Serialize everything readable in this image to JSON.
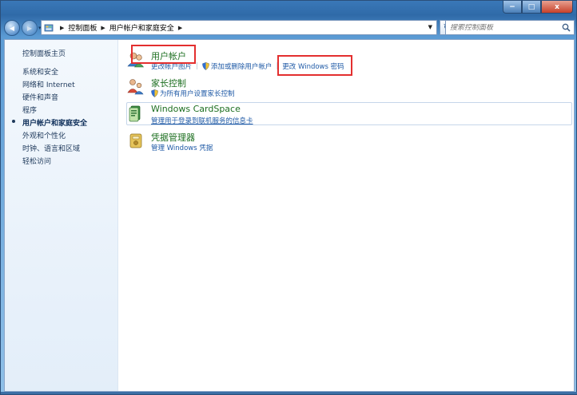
{
  "window": {
    "buttons": {
      "minimize": "−",
      "maximize": "□",
      "close": "x"
    }
  },
  "navbar": {
    "back_glyph": "◀",
    "forward_glyph": "▶",
    "breadcrumb": [
      "控制面板",
      "用户帐户和家庭安全"
    ],
    "separator": "▶",
    "refresh_glyph": "↻",
    "search_placeholder": "搜索控制面板"
  },
  "sidebar": {
    "items": [
      {
        "label": "控制面板主页"
      },
      {
        "label": "系统和安全"
      },
      {
        "label": "网络和 Internet"
      },
      {
        "label": "硬件和声音"
      },
      {
        "label": "程序"
      },
      {
        "label": "用户帐户和家庭安全",
        "active": true
      },
      {
        "label": "外观和个性化"
      },
      {
        "label": "时钟、语言和区域"
      },
      {
        "label": "轻松访问"
      }
    ]
  },
  "sections": [
    {
      "title": "用户帐户",
      "icon": "users-icon",
      "links": [
        "更改帐户图片",
        "添加或删除用户帐户",
        "更改 Windows 密码"
      ]
    },
    {
      "title": "家长控制",
      "icon": "family-icon",
      "links": [
        "为所有用户设置家长控制"
      ]
    },
    {
      "title": "Windows CardSpace",
      "icon": "cardspace-icon",
      "links": [
        "管理用于登录到联机服务的信息卡"
      ]
    },
    {
      "title": "凭据管理器",
      "icon": "credential-icon",
      "links": [
        "管理 Windows 凭据"
      ]
    }
  ],
  "colors": {
    "link": "#1f5aa6",
    "title_green": "#1d6f20",
    "highlight": "#e32f2f",
    "frame": "#3a78b8"
  }
}
